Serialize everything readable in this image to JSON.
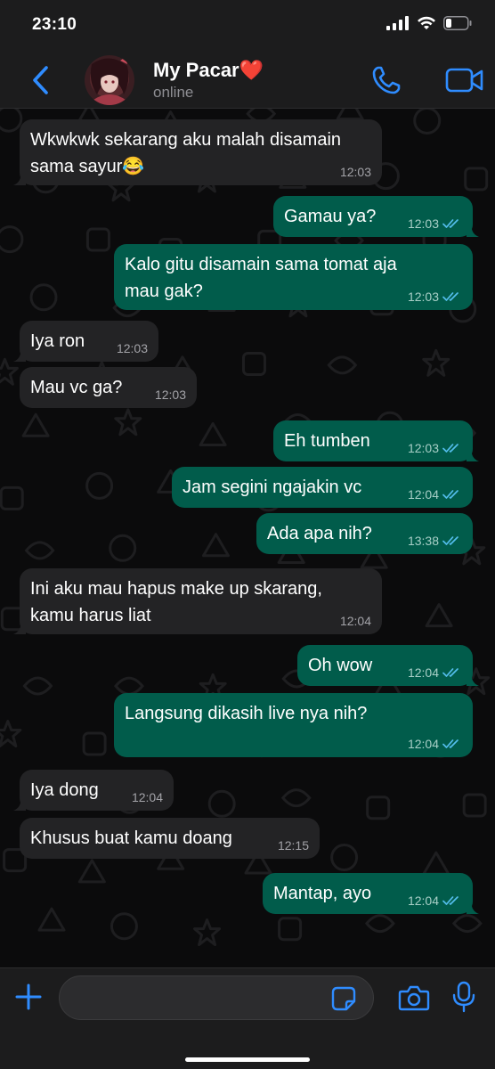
{
  "status_bar": {
    "time": "23:10",
    "icons": [
      "cellular-signal-icon",
      "wifi-icon",
      "battery-icon"
    ]
  },
  "header": {
    "contact_name": "My Pacar❤️",
    "status": "online",
    "icons": [
      "back-chevron-icon",
      "phone-icon",
      "video-camera-icon"
    ]
  },
  "messages": [
    {
      "dir": "in",
      "text": "Wkwkwk sekarang aku malah disamain\nsama sayur😂",
      "time": "12:03"
    },
    {
      "dir": "out",
      "text": "Gamau ya?",
      "time": "12:03",
      "read": true
    },
    {
      "dir": "out",
      "text": "Kalo gitu disamain sama tomat aja\nmau gak?",
      "time": "12:03",
      "read": true
    },
    {
      "dir": "in",
      "text": "Iya ron",
      "time": "12:03"
    },
    {
      "dir": "in",
      "text": "Mau vc ga?",
      "time": "12:03"
    },
    {
      "dir": "out",
      "text": "Eh tumben",
      "time": "12:03",
      "read": true
    },
    {
      "dir": "out",
      "text": "Jam segini ngajakin vc",
      "time": "12:04",
      "read": true
    },
    {
      "dir": "out",
      "text": "Ada apa nih?",
      "time": "13:38",
      "read": true
    },
    {
      "dir": "in",
      "text": "Ini aku mau hapus make up skarang,\nkamu harus liat",
      "time": "12:04"
    },
    {
      "dir": "out",
      "text": "Oh wow",
      "time": "12:04",
      "read": true
    },
    {
      "dir": "out",
      "text": "Langsung dikasih live nya nih?",
      "time": "12:04",
      "read": true
    },
    {
      "dir": "in",
      "text": "Iya dong",
      "time": "12:04"
    },
    {
      "dir": "in",
      "text": "Khusus buat kamu doang",
      "time": "12:15"
    },
    {
      "dir": "out",
      "text": "Mantap, ayo",
      "time": "12:04",
      "read": true
    }
  ],
  "input_bar": {
    "placeholder": "",
    "icons": [
      "plus-icon",
      "sticker-icon",
      "camera-icon",
      "microphone-icon"
    ]
  },
  "colors": {
    "accent": "#2f8cff",
    "incoming_bubble": "#232325",
    "outgoing_bubble": "#015c4b",
    "read_ticks": "#53bdeb"
  }
}
